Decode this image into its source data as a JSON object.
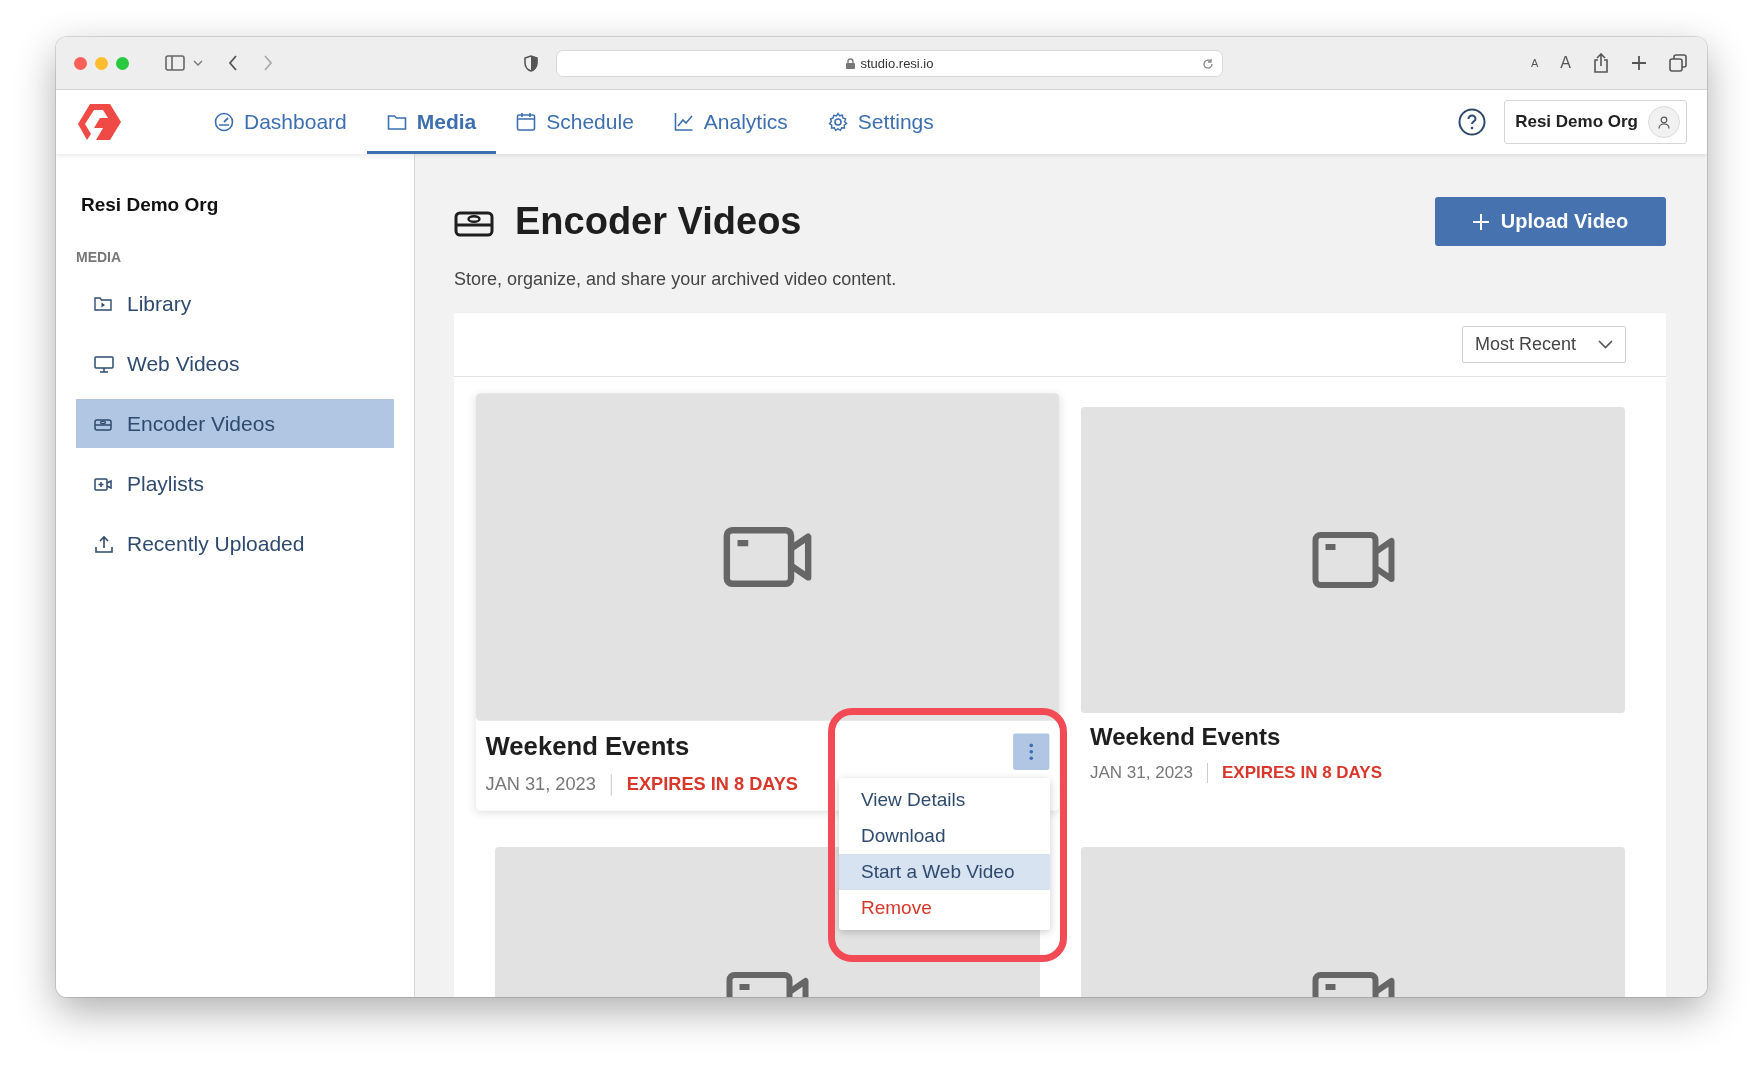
{
  "browser": {
    "url": "studio.resi.io",
    "text_buttons": [
      "A",
      "A"
    ]
  },
  "nav": {
    "tabs": [
      {
        "label": "Dashboard",
        "selected": false
      },
      {
        "label": "Media",
        "selected": true
      },
      {
        "label": "Schedule",
        "selected": false
      },
      {
        "label": "Analytics",
        "selected": false
      },
      {
        "label": "Settings",
        "selected": false
      }
    ]
  },
  "account": {
    "org": "Resi Demo Org"
  },
  "sidebar": {
    "org": "Resi Demo Org",
    "section": "MEDIA",
    "items": [
      {
        "label": "Library",
        "selected": false
      },
      {
        "label": "Web Videos",
        "selected": false
      },
      {
        "label": "Encoder Videos",
        "selected": true
      },
      {
        "label": "Playlists",
        "selected": false
      },
      {
        "label": "Recently Uploaded",
        "selected": false
      }
    ]
  },
  "page": {
    "title": "Encoder Videos",
    "subtitle": "Store, organize, and share your archived video content.",
    "upload_button": "Upload Video"
  },
  "sort": {
    "value": "Most Recent"
  },
  "videos": [
    {
      "kind": "full",
      "title": "Weekend Events",
      "date": "JAN 31, 2023",
      "expiry": "EXPIRES IN 8 DAYS",
      "hovered": true
    },
    {
      "kind": "full",
      "title": "Weekend Events",
      "date": "JAN 31, 2023",
      "expiry": "EXPIRES IN 8 DAYS",
      "hovered": false
    },
    {
      "kind": "thumbnail_only"
    },
    {
      "kind": "thumbnail_only"
    }
  ],
  "menu": {
    "items": [
      {
        "label": "View Details",
        "kind": "normal",
        "selected": false
      },
      {
        "label": "Download",
        "kind": "normal",
        "selected": false
      },
      {
        "label": "Start a Web Video",
        "kind": "normal",
        "selected": true
      },
      {
        "label": "Remove",
        "kind": "danger",
        "selected": false
      }
    ]
  },
  "callout": {
    "kind": "rounded-outline"
  }
}
